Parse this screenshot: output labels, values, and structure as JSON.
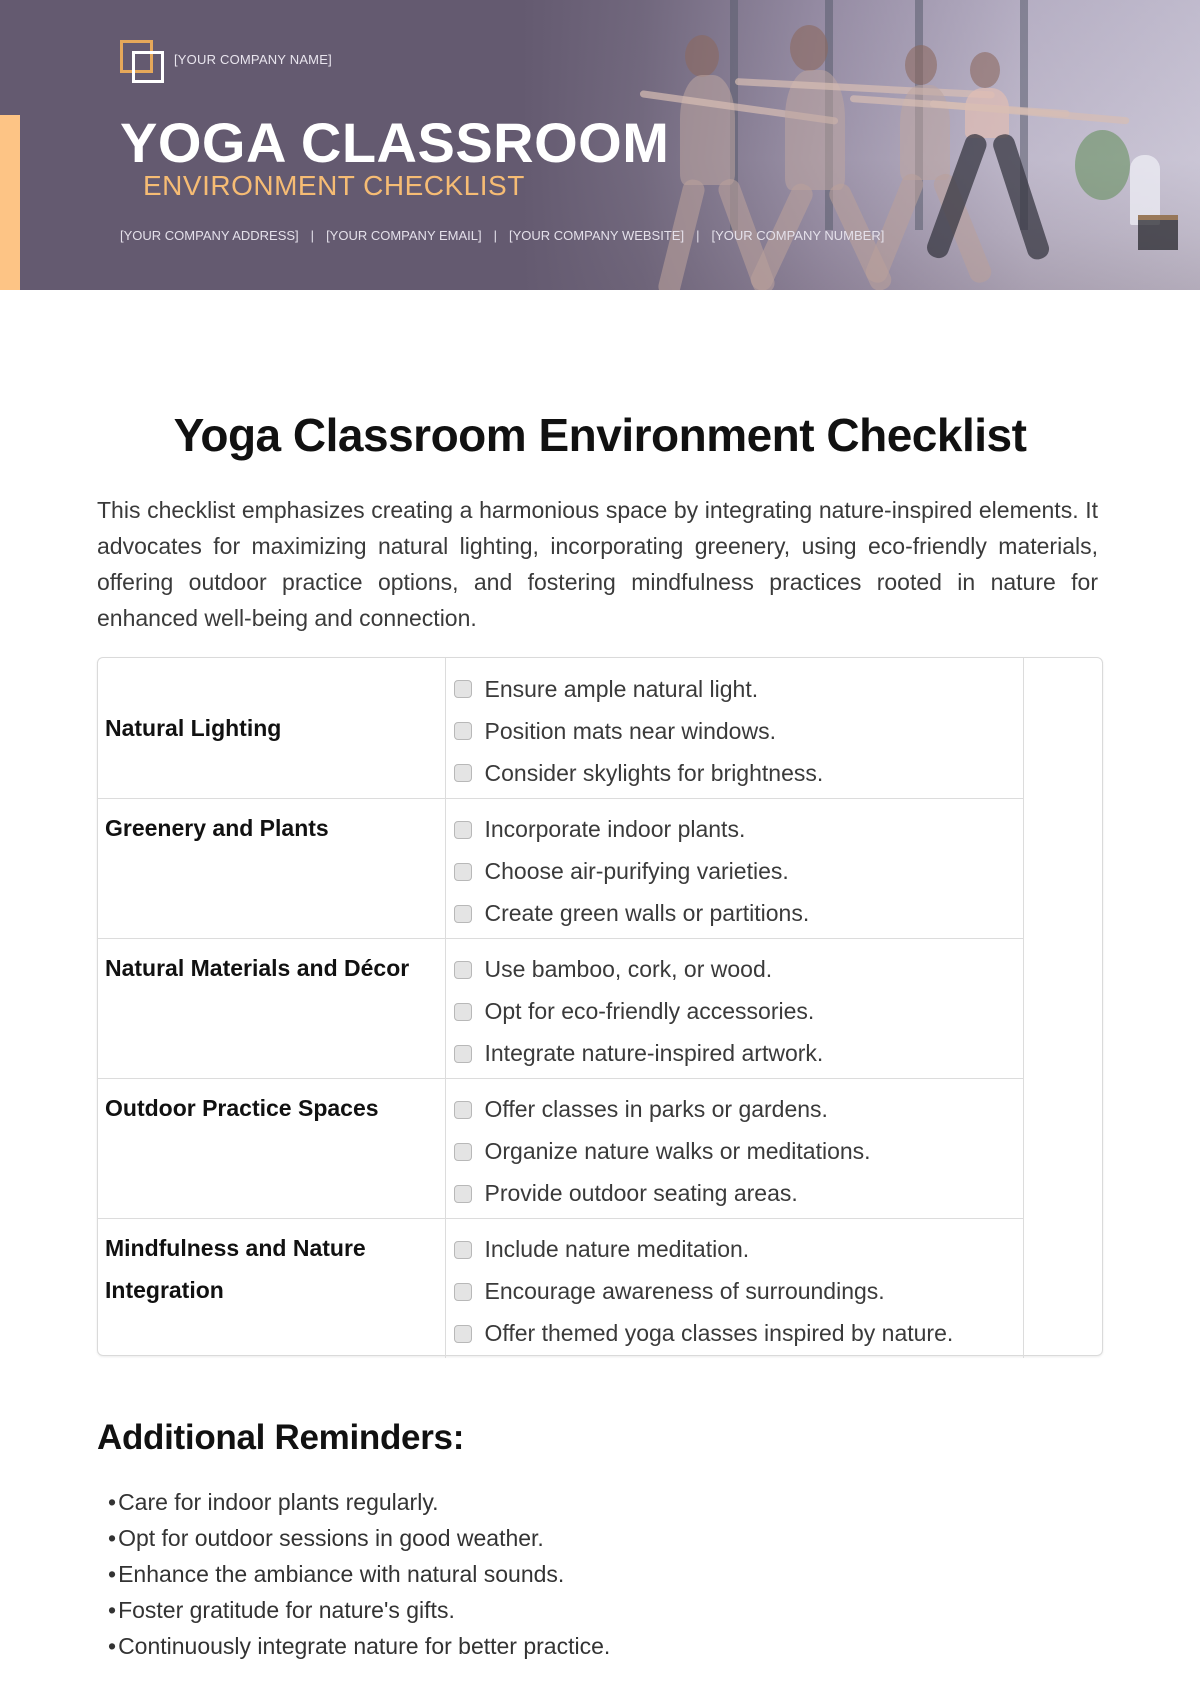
{
  "header": {
    "company_name": "[YOUR COMPANY NAME]",
    "title": "YOGA CLASSROOM",
    "subtitle": "ENVIRONMENT CHECKLIST",
    "contacts": [
      "[YOUR COMPANY ADDRESS]",
      "[YOUR COMPANY EMAIL]",
      "[YOUR COMPANY WEBSITE]",
      "[YOUR COMPANY NUMBER]"
    ],
    "separator": "|",
    "logo_icon": "overlapping-squares-icon",
    "banner_image": "yoga-class-photo"
  },
  "colors": {
    "banner_bg": "#645a70",
    "accent_orange": "#fdc485",
    "subtitle_orange": "#f6bc74",
    "text_dark": "#111111"
  },
  "document": {
    "title": "Yoga Classroom Environment Checklist",
    "intro": "This checklist emphasizes creating a harmonious space by integrating nature-inspired elements. It advocates for maximizing natural lighting, incorporating greenery, using eco-friendly materials, offering outdoor practice options, and fostering mindfulness practices rooted in nature for enhanced well-being and connection."
  },
  "checklist": [
    {
      "category": "Natural Lighting",
      "items": [
        {
          "label": "Ensure ample natural light.",
          "checked": false
        },
        {
          "label": "Position mats near windows.",
          "checked": false
        },
        {
          "label": "Consider skylights for brightness.",
          "checked": false
        }
      ]
    },
    {
      "category": "Greenery and Plants",
      "items": [
        {
          "label": "Incorporate indoor plants.",
          "checked": false
        },
        {
          "label": "Choose air-purifying varieties.",
          "checked": false
        },
        {
          "label": "Create green walls or partitions.",
          "checked": false
        }
      ]
    },
    {
      "category": "Natural Materials and Décor",
      "items": [
        {
          "label": "Use bamboo, cork, or wood.",
          "checked": false
        },
        {
          "label": "Opt for eco-friendly accessories.",
          "checked": false
        },
        {
          "label": "Integrate nature-inspired artwork.",
          "checked": false
        }
      ]
    },
    {
      "category": "Outdoor Practice Spaces",
      "items": [
        {
          "label": "Offer classes in parks or gardens.",
          "checked": false
        },
        {
          "label": "Organize nature walks or meditations.",
          "checked": false
        },
        {
          "label": "Provide outdoor seating areas.",
          "checked": false
        }
      ]
    },
    {
      "category": "Mindfulness and Nature Integration",
      "items": [
        {
          "label": "Include nature meditation.",
          "checked": false
        },
        {
          "label": "Encourage awareness of surroundings.",
          "checked": false
        },
        {
          "label": "Offer themed yoga classes inspired by nature.",
          "checked": false
        }
      ]
    }
  ],
  "reminders": {
    "title": "Additional Reminders:",
    "bullet": "•",
    "items": [
      "Care for indoor plants regularly.",
      "Opt for outdoor sessions in good weather.",
      "Enhance the ambiance with natural sounds.",
      "Foster gratitude for nature's gifts.",
      "Continuously integrate nature for better practice."
    ]
  }
}
